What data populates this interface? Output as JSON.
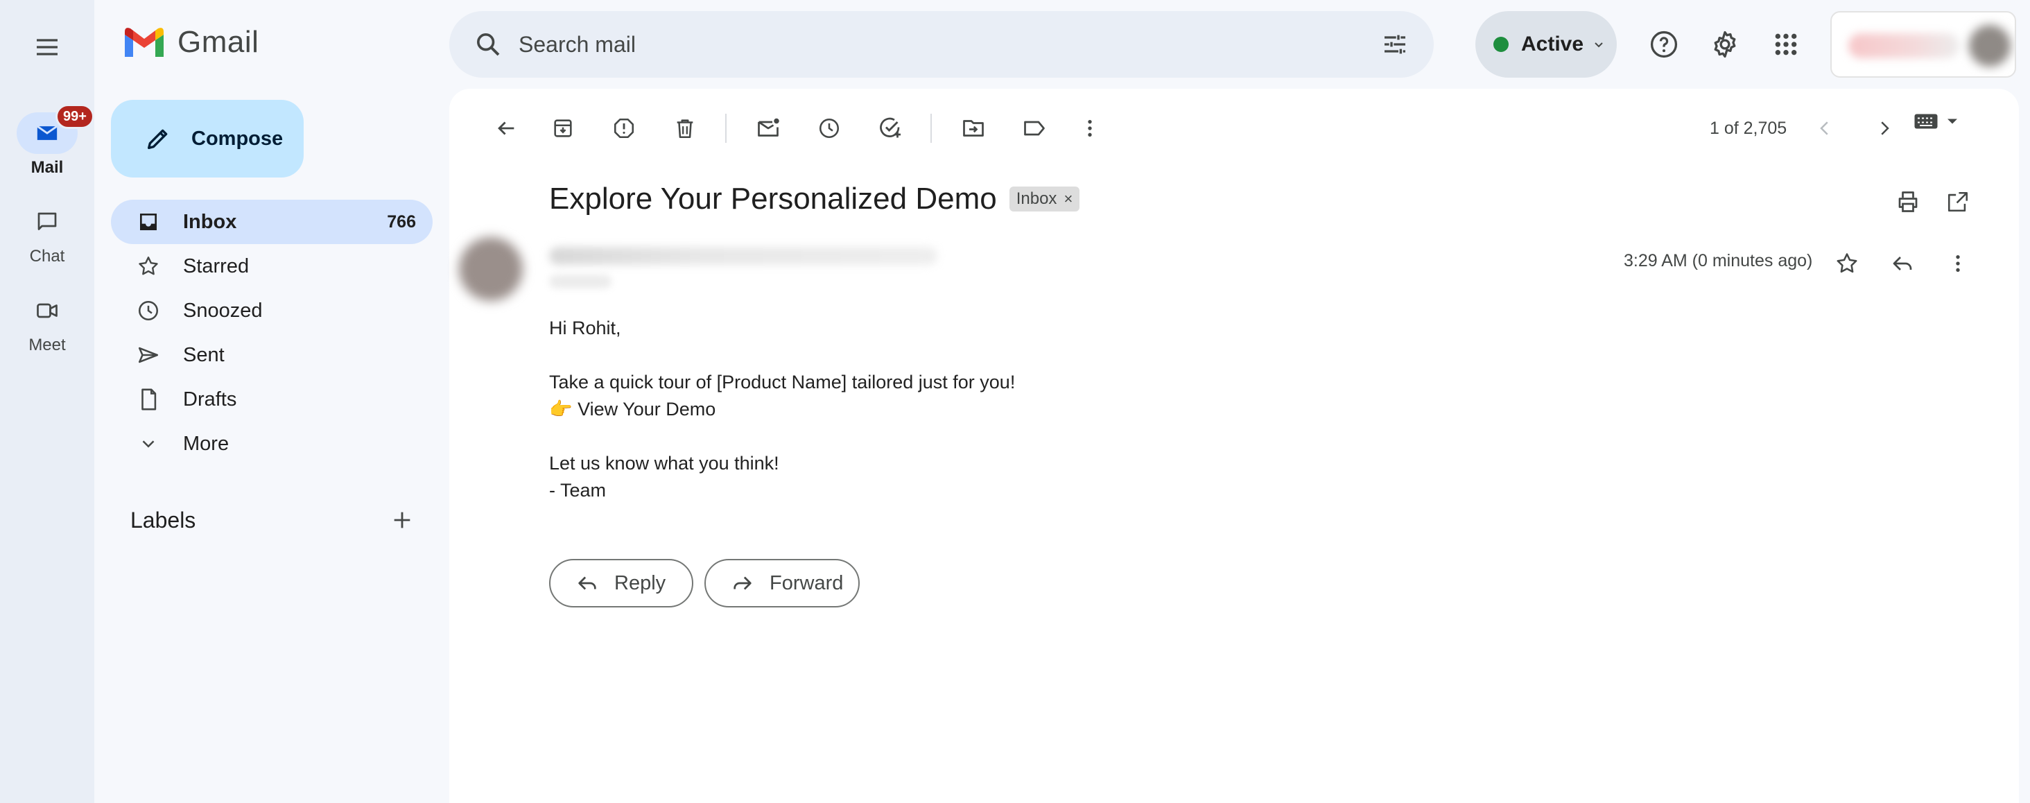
{
  "app": {
    "name": "Gmail"
  },
  "rail": {
    "items": [
      {
        "label": "Mail",
        "badge": "99+",
        "icon": "mail-icon"
      },
      {
        "label": "Chat",
        "icon": "chat-icon"
      },
      {
        "label": "Meet",
        "icon": "video-icon"
      }
    ]
  },
  "search": {
    "placeholder": "Search mail"
  },
  "status": {
    "label": "Active",
    "color": "#1e8e3e"
  },
  "compose": {
    "label": "Compose"
  },
  "nav": {
    "items": [
      {
        "label": "Inbox",
        "count": "766"
      },
      {
        "label": "Starred"
      },
      {
        "label": "Snoozed"
      },
      {
        "label": "Sent"
      },
      {
        "label": "Drafts"
      },
      {
        "label": "More"
      }
    ]
  },
  "labels": {
    "title": "Labels"
  },
  "toolbar": {
    "pager": "1 of 2,705"
  },
  "email": {
    "subject": "Explore Your Personalized Demo",
    "label_chip": "Inbox",
    "time": "3:29 AM (0 minutes ago)",
    "body": {
      "greeting": "Hi Rohit,",
      "line1": "Take a quick tour of [Product Name] tailored just for you!",
      "line2": "👉 View Your Demo",
      "line3": "Let us know what you think!",
      "line4": "- Team"
    }
  },
  "actions": {
    "reply": "Reply",
    "forward": "Forward"
  },
  "colors": {
    "accent": "#d3e3fd",
    "compose": "#c2e7ff",
    "badge": "#b3261e",
    "background": "#f6f8fc"
  }
}
